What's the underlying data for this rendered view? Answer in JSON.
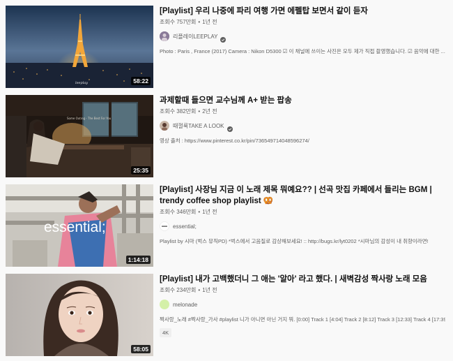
{
  "videos": [
    {
      "title": "[Playlist] 우리 나중에 파리 여행 가면 에펠탑 보면서 같이 듣자",
      "views": "조회수 757만회",
      "age": "1년 전",
      "channel": "리플레이LEEPLAY",
      "verified": true,
      "description": "Photo : Paris , France (2017) Camera : Nikon D5300 ☑ 이 채널에 쓰이는 사진은 모두 제가 직접 촬영했습니다. ☑ 음악에 대한 ...",
      "duration": "58:22"
    },
    {
      "title": "과제할때 들으면 교수님께 A+ 받는 팝송",
      "views": "조회수 382만회",
      "age": "2년 전",
      "channel": "때껄룩TAKE A LOOK",
      "verified": true,
      "description": "영상 출처 : https://www.pinterest.co.kr/pin/736549714048596274/",
      "duration": "25:35",
      "thumb_caption": "Some Outing - The Best For You"
    },
    {
      "title": "[Playlist] 사장님 지금 이 노래 제목 뭐예요?? | 선곡 맛집 카페에서 들리는 BGM | trendy coffee shop playlist 🥨",
      "views": "조회수 346만회",
      "age": "1년 전",
      "channel": "essential;",
      "verified": false,
      "description": "Playlist by 시마 (벅스 뮤직PD) *벅스에서 고음질로 감상해보세요! :: http://bugs.kr/lyt0202 *시마님의 감성이 내 취향이라면!",
      "duration": "1:14:18",
      "thumb_text": "essential;"
    },
    {
      "title": "[Playlist] 내가 고백했더니 그 애는 '알아' 라고 했다. | 새벽감성 짝사랑 노래 모음",
      "views": "조회수 234만회",
      "age": "1년 전",
      "channel": "melonade",
      "verified": false,
      "description": "짝사랑_노래 #짝사랑_가사 #playlist 니가 아니면 아닌 거지 뭐. [0:00] Track 1 [4:04] Track 2 [8:12] Track 3 [12:33] Track 4 [17:39] ...",
      "badge": "4K",
      "duration": "58:05"
    }
  ],
  "dot": "•"
}
